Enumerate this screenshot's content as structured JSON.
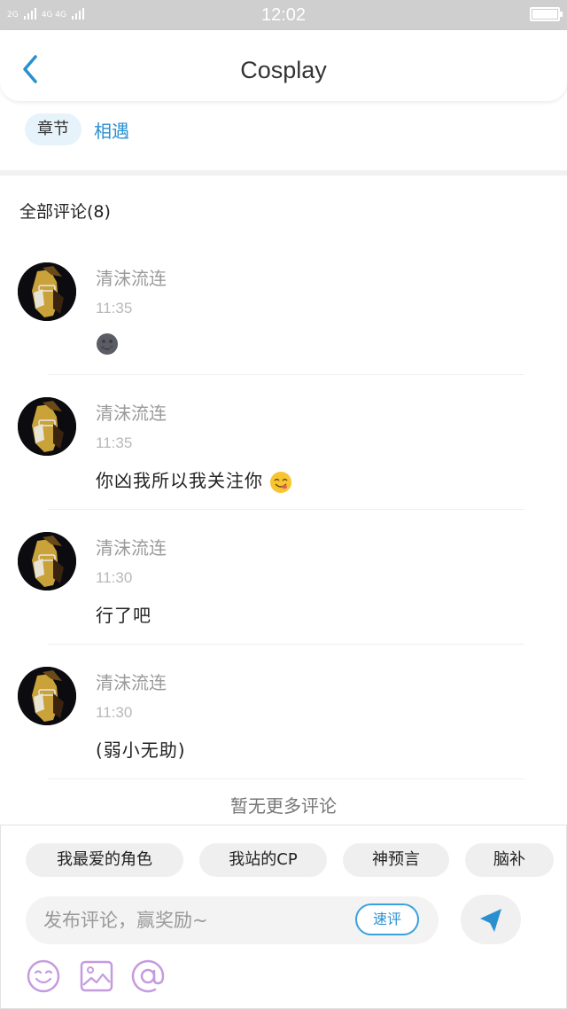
{
  "status_bar": {
    "network_1": "2G",
    "network_2": "4G 4G",
    "time": "12:02",
    "battery_icon": "battery-icon"
  },
  "header": {
    "back_icon": "chevron-left-icon",
    "title": "Cosplay"
  },
  "tags": {
    "chapter_label": "章节",
    "chapter_value": "相遇"
  },
  "comments": {
    "heading": "全部评论(8)",
    "items": [
      {
        "name": "清沫流连",
        "time": "11:35",
        "text": "",
        "emoji": "new-moon-face-emoji"
      },
      {
        "name": "清沫流连",
        "time": "11:35",
        "text": "你凶我所以我关注你",
        "emoji": "yum-face-emoji"
      },
      {
        "name": "清沫流连",
        "time": "11:30",
        "text": "行了吧",
        "emoji": ""
      },
      {
        "name": "清沫流连",
        "time": "11:30",
        "text": "(弱小无助)",
        "emoji": ""
      }
    ],
    "no_more": "暂无更多评论"
  },
  "composer": {
    "quick_tags": [
      "我最爱的角色",
      "我站的CP",
      "神预言",
      "脑补"
    ],
    "placeholder": "发布评论，赢奖励~",
    "value": "",
    "quick_rate": "速评",
    "send_icon": "send-icon",
    "tools": [
      "emoji-icon",
      "image-icon",
      "mention-icon"
    ]
  },
  "colors": {
    "accent": "#2a8fd0",
    "chip_bg": "#e6f3fb",
    "tool_purple": "#c49be0",
    "status_bar_bg": "#cfcfcf"
  }
}
